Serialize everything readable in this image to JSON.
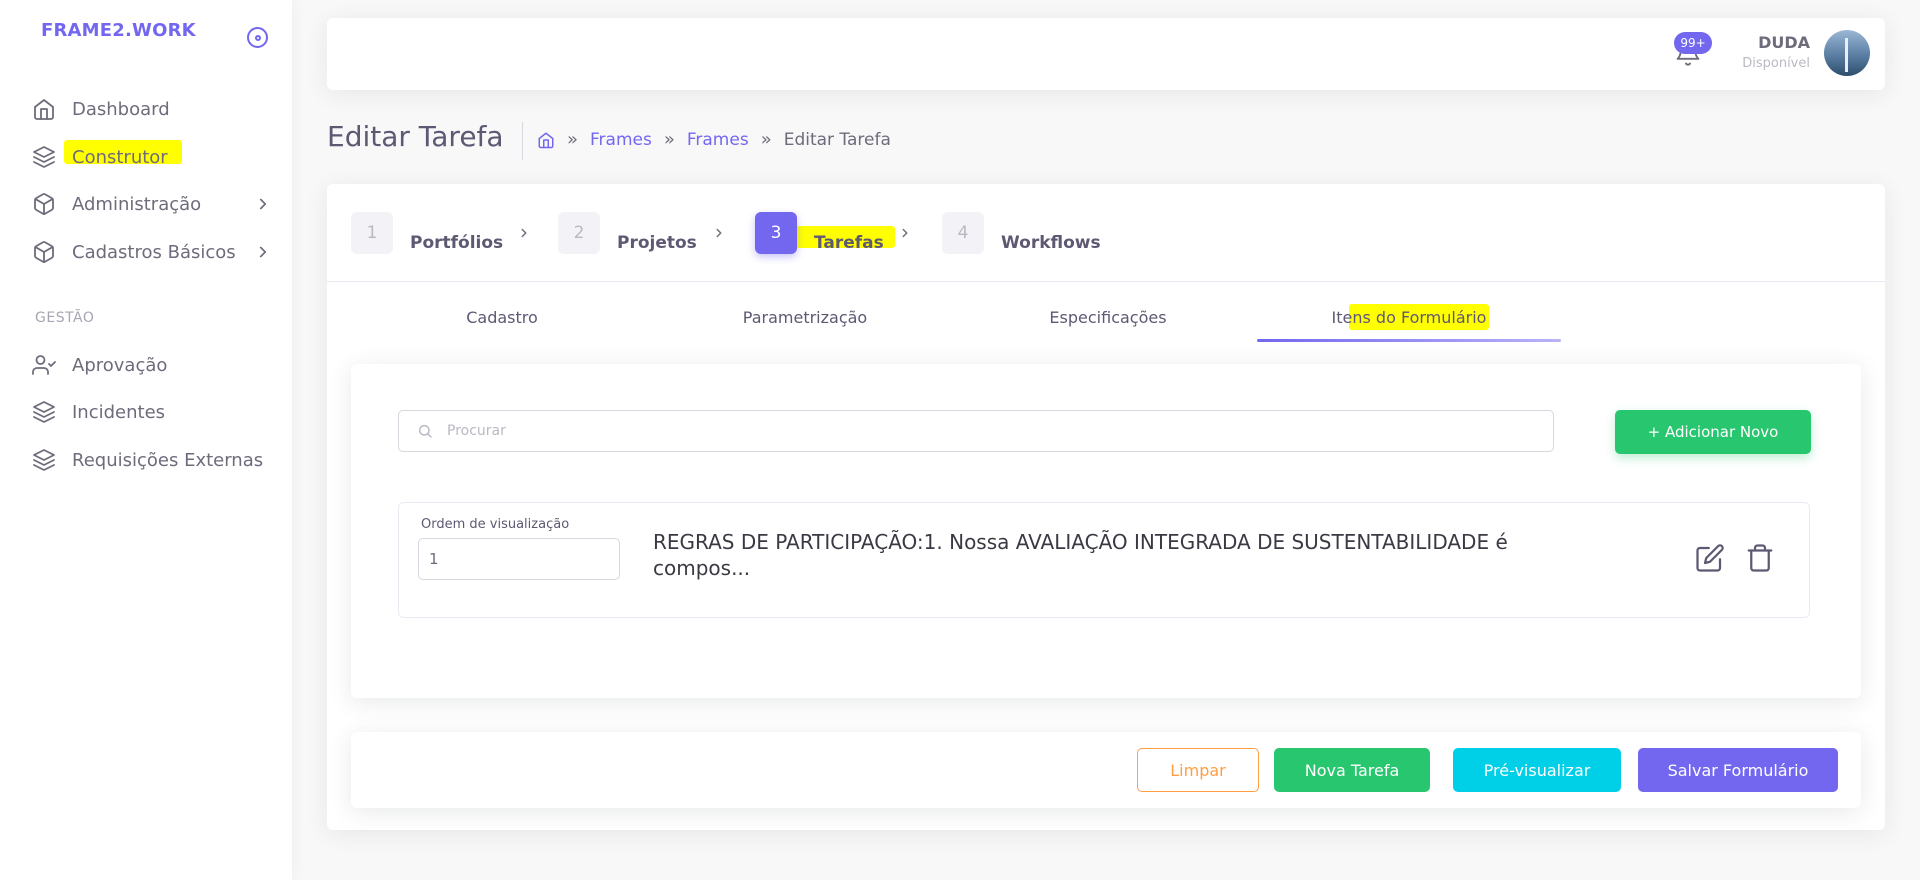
{
  "app": {
    "brand": "FRAME2.WORK"
  },
  "sidebar": {
    "items": [
      {
        "label": "Dashboard",
        "icon": "home-icon"
      },
      {
        "label": "Construtor",
        "icon": "layers-icon"
      },
      {
        "label": "Administração",
        "icon": "package-icon"
      },
      {
        "label": "Cadastros Básicos",
        "icon": "package-icon"
      }
    ],
    "section": "GESTÃO",
    "section_items": [
      {
        "label": "Aprovação",
        "icon": "user-check-icon"
      },
      {
        "label": "Incidentes",
        "icon": "layers-icon"
      },
      {
        "label": "Requisições Externas",
        "icon": "layers-icon"
      }
    ]
  },
  "header": {
    "notifications": "99+",
    "user_name": "DUDA",
    "user_status": "Disponível"
  },
  "page": {
    "title": "Editar Tarefa",
    "breadcrumb": [
      "Frames",
      "Frames",
      "Editar Tarefa"
    ]
  },
  "steps": [
    {
      "num": "1",
      "label": "Portfólios"
    },
    {
      "num": "2",
      "label": "Projetos"
    },
    {
      "num": "3",
      "label": "Tarefas"
    },
    {
      "num": "4",
      "label": "Workflows"
    }
  ],
  "tabs": [
    "Cadastro",
    "Parametrização",
    "Especificações",
    "Itens do Formulário"
  ],
  "search": {
    "placeholder": "Procurar"
  },
  "add_button": "+ Adicionar Novo",
  "item": {
    "order_label": "Ordem de visualização",
    "order_value": "1",
    "text": "REGRAS DE PARTICIPAÇÃO:1. Nossa AVALIAÇÃO INTEGRADA DE SUSTENTABILIDADE é compos..."
  },
  "footer": {
    "clear": "Limpar",
    "new_task": "Nova Tarefa",
    "preview": "Pré-visualizar",
    "save": "Salvar Formulário"
  },
  "colors": {
    "primary": "#7367f0",
    "success": "#28c76f",
    "info": "#00cfe8",
    "warning": "#ff9f43",
    "highlight": "#ffff00"
  }
}
